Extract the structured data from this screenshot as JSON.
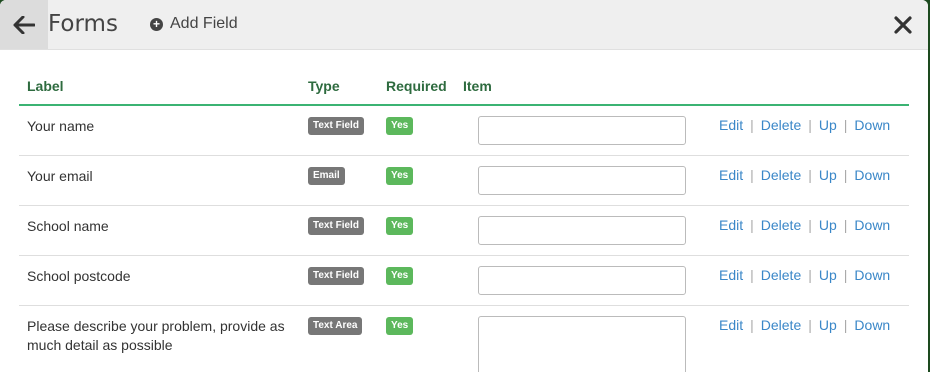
{
  "header": {
    "title": "Forms",
    "add_field_label": "Add Field",
    "back_icon": "arrow-left-icon",
    "close_icon": "close-icon"
  },
  "table": {
    "columns": [
      "Label",
      "Type",
      "Required",
      "Item"
    ],
    "rows": [
      {
        "label": "Your name",
        "type": "Text Field",
        "required": "Yes"
      },
      {
        "label": "Your email",
        "type": "Email",
        "required": "Yes"
      },
      {
        "label": "School name",
        "type": "Text Field",
        "required": "Yes"
      },
      {
        "label": "School postcode",
        "type": "Text Field",
        "required": "Yes"
      },
      {
        "label": "Please describe your problem, provide as much detail as possible",
        "type": "Text Area",
        "required": "Yes"
      }
    ],
    "actions": {
      "edit": "Edit",
      "delete": "Delete",
      "up": "Up",
      "down": "Down",
      "separator": "|"
    }
  },
  "colors": {
    "accent_green": "#3bb373",
    "header_text_green": "#2e6b3f",
    "link_blue": "#3a87c8",
    "badge_gray": "#777777",
    "badge_green": "#5cb85c"
  }
}
